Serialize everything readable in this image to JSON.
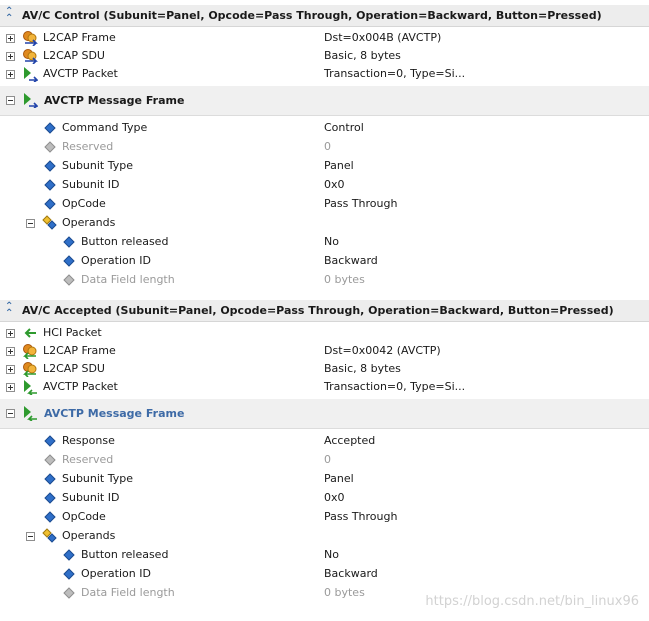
{
  "packets": [
    {
      "title": "AV/C Control (Subunit=Panel, Opcode=Pass Through, Operation=Backward, Button=Pressed)",
      "layers": [
        {
          "label": "L2CAP Frame",
          "value": "Dst=0x004B (AVCTP)"
        },
        {
          "label": "L2CAP SDU",
          "value": "Basic, 8 bytes"
        },
        {
          "label": "AVCTP Packet",
          "value": "Transaction=0, Type=Si..."
        }
      ],
      "frame_title": "AVCTP Message Frame",
      "fields": [
        {
          "label": "Command Type",
          "value": "Control"
        },
        {
          "label": "Reserved",
          "value": "0"
        },
        {
          "label": "Subunit Type",
          "value": "Panel"
        },
        {
          "label": "Subunit ID",
          "value": "0x0"
        },
        {
          "label": "OpCode",
          "value": "Pass Through"
        }
      ],
      "operands_label": "Operands",
      "operands": [
        {
          "label": "Button released",
          "value": "No"
        },
        {
          "label": "Operation ID",
          "value": "Backward"
        },
        {
          "label": "Data Field length",
          "value": "0 bytes"
        }
      ]
    },
    {
      "title": "AV/C Accepted (Subunit=Panel, Opcode=Pass Through, Operation=Backward, Button=Pressed)",
      "hci_label": "HCI Packet",
      "layers": [
        {
          "label": "L2CAP Frame",
          "value": "Dst=0x0042 (AVCTP)"
        },
        {
          "label": "L2CAP SDU",
          "value": "Basic, 8 bytes"
        },
        {
          "label": "AVCTP Packet",
          "value": "Transaction=0, Type=Si..."
        }
      ],
      "frame_title": "AVCTP Message Frame",
      "fields": [
        {
          "label": "Response",
          "value": "Accepted"
        },
        {
          "label": "Reserved",
          "value": "0"
        },
        {
          "label": "Subunit Type",
          "value": "Panel"
        },
        {
          "label": "Subunit ID",
          "value": "0x0"
        },
        {
          "label": "OpCode",
          "value": "Pass Through"
        }
      ],
      "operands_label": "Operands",
      "operands": [
        {
          "label": "Button released",
          "value": "No"
        },
        {
          "label": "Operation ID",
          "value": "Backward"
        },
        {
          "label": "Data Field length",
          "value": "0 bytes"
        }
      ]
    }
  ],
  "watermark": "https://blog.csdn.net/bin_linux96",
  "colors": {
    "accent_blue": "#3d6aa6",
    "header_bg": "#ededed",
    "muted_text": "#9a9a9a",
    "arrow_green": "#2e9a2e"
  }
}
